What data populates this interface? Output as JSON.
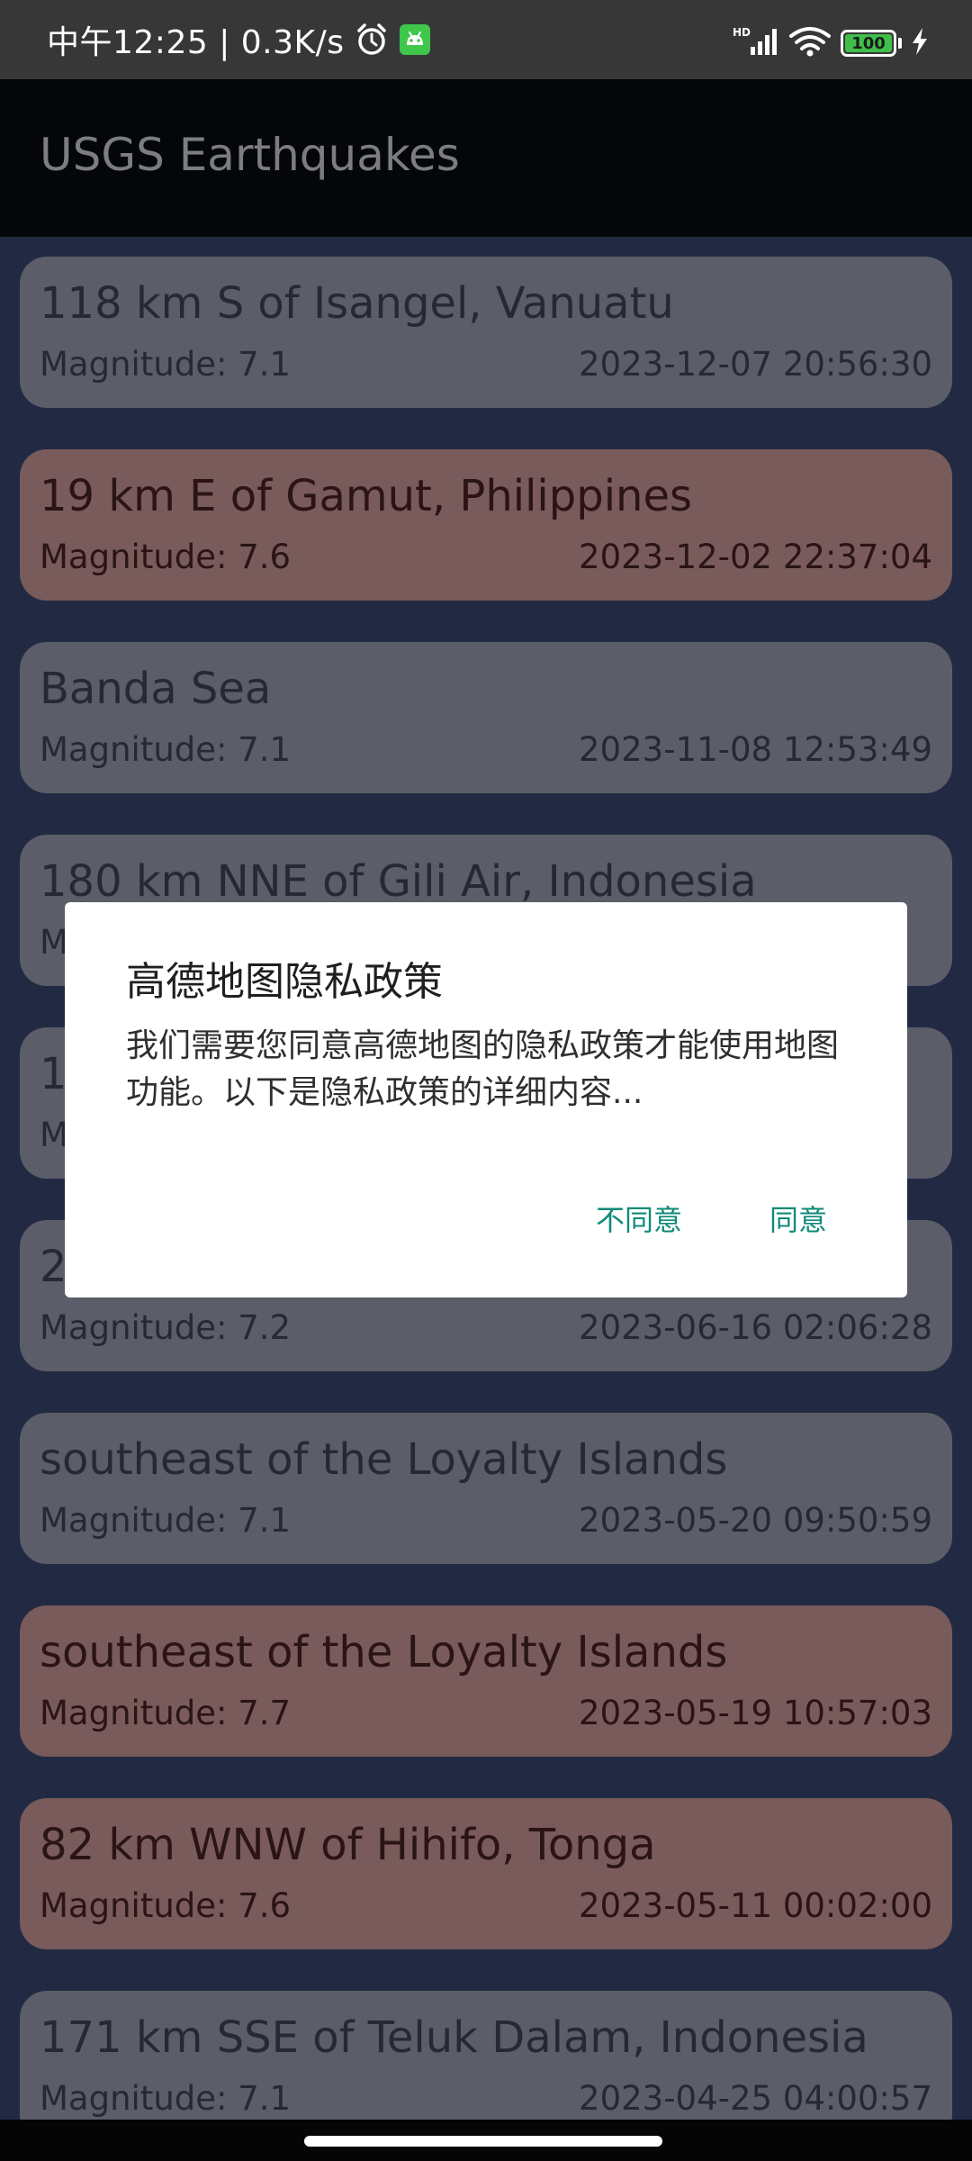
{
  "status_bar": {
    "time_text": "中午12:25 | 0.3K/s",
    "battery_level": "100",
    "battery_fill_fraction": 1.0,
    "battery_color": "#3fbf4a",
    "network_badge": "HD",
    "icons": [
      "alarm-icon",
      "android-icon",
      "signal-icon",
      "wifi-icon",
      "battery-icon",
      "charging-icon"
    ]
  },
  "app_bar": {
    "title": "USGS Earthquakes"
  },
  "colors": {
    "card_normal": "#5b5d68",
    "card_strong": "#785b5a",
    "list_background": "#222a43",
    "dialog_button": "#0f8a79"
  },
  "quakes": [
    {
      "place": "118 km S of Isangel, Vanuatu",
      "magnitude": "Magnitude: 7.1",
      "time": "2023-12-07 20:56:30",
      "level": "normal"
    },
    {
      "place": "19 km E of Gamut, Philippines",
      "magnitude": "Magnitude: 7.6",
      "time": "2023-12-02 22:37:04",
      "level": "strong"
    },
    {
      "place": "Banda Sea",
      "magnitude": "Magnitude: 7.1",
      "time": "2023-11-08 12:53:49",
      "level": "normal"
    },
    {
      "place": "180 km NNE of Gili Air, Indonesia",
      "magnitude": "Magnitude:",
      "time": "",
      "level": "normal"
    },
    {
      "place": "10",
      "magnitude": "Magnitude:",
      "time": "",
      "level": "normal"
    },
    {
      "place": "2",
      "magnitude": "Magnitude: 7.2",
      "time": "2023-06-16 02:06:28",
      "level": "normal"
    },
    {
      "place": "southeast of the Loyalty Islands",
      "magnitude": "Magnitude: 7.1",
      "time": "2023-05-20 09:50:59",
      "level": "normal"
    },
    {
      "place": "southeast of the Loyalty Islands",
      "magnitude": "Magnitude: 7.7",
      "time": "2023-05-19 10:57:03",
      "level": "strong"
    },
    {
      "place": "82 km WNW of Hihifo, Tonga",
      "magnitude": "Magnitude: 7.6",
      "time": "2023-05-11 00:02:00",
      "level": "strong"
    },
    {
      "place": "171 km SSE of Teluk Dalam, Indonesia",
      "magnitude": "Magnitude: 7.1",
      "time": "2023-04-25 04:00:57",
      "level": "normal"
    }
  ],
  "dialog": {
    "title": "高德地图隐私政策",
    "message": "我们需要您同意高德地图的隐私政策才能使用地图功能。以下是隐私政策的详细内容...",
    "negative_button": "不同意",
    "positive_button": "同意"
  }
}
